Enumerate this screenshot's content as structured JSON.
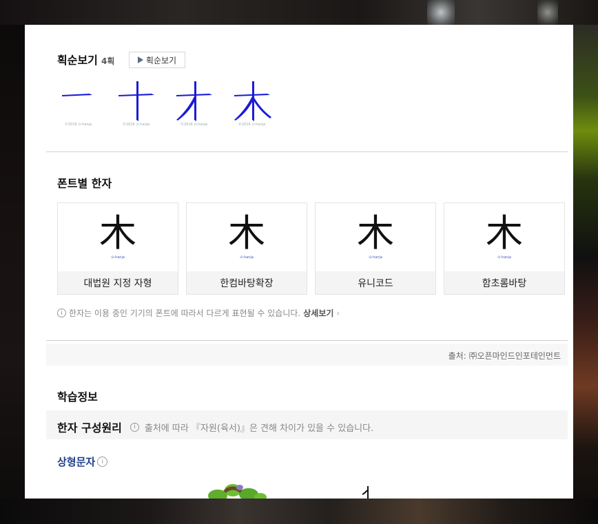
{
  "stroke_section": {
    "title": "획순보기",
    "count": "4획",
    "play_label": "획순보기",
    "frames": [
      {
        "glyph": "一",
        "copyright": "©2016 ⊙-hanja"
      },
      {
        "glyph": "十",
        "copyright": "©2016 ⊙-hanja"
      },
      {
        "glyph": "才",
        "copyright": "©2016 ⊙-hanja"
      },
      {
        "glyph": "木",
        "copyright": "©2016 ⊙-hanja"
      }
    ],
    "stroke_color": "#1a1ad6"
  },
  "font_section": {
    "title": "폰트별 한자",
    "cards": [
      {
        "glyph": "木",
        "mark": "⊙-hanja",
        "label": "대법원 지정 자형"
      },
      {
        "glyph": "木",
        "mark": "⊙-hanja",
        "label": "한컴바탕확장"
      },
      {
        "glyph": "木",
        "mark": "⊙-hanja",
        "label": "유니코드"
      },
      {
        "glyph": "木",
        "mark": "⊙-hanja",
        "label": "함초롬바탕"
      }
    ],
    "note": "한자는 이용 중인 기기의 폰트에 따라서 다르게 표현될 수 있습니다.",
    "detail_link": "상세보기"
  },
  "source": "출처: ㈜오픈마인드인포테인먼트",
  "study_section": {
    "title": "학습정보",
    "principle_title": "한자 구성원리",
    "principle_note": "출처에 따라 『자원(육서)』은 견해 차이가 있을 수 있습니다.",
    "category_link": "상형문자"
  }
}
